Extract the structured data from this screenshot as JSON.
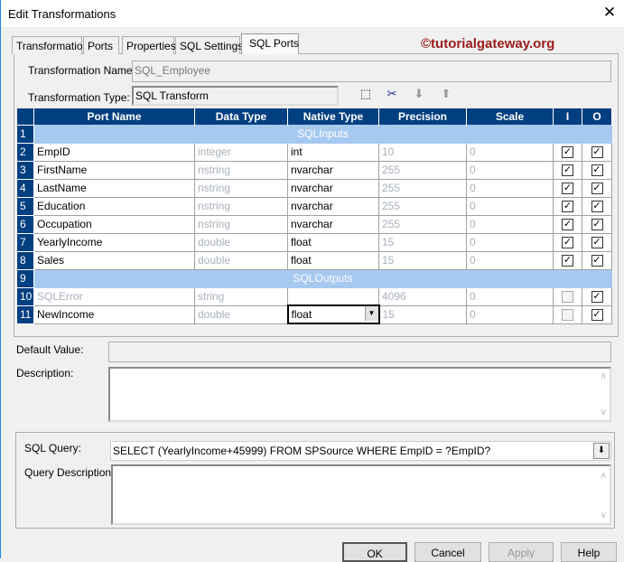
{
  "window": {
    "title": "Edit Transformations",
    "close_icon": "close-icon"
  },
  "tabs": [
    {
      "label": "Transformation"
    },
    {
      "label": "Ports"
    },
    {
      "label": "Properties"
    },
    {
      "label": "SQL Settings"
    },
    {
      "label": "SQL Ports",
      "selected": true
    }
  ],
  "watermark": "©tutorialgateway.org",
  "form": {
    "name_label": "Transformation Name:",
    "name_value": "SQL_Employee",
    "type_label": "Transformation Type:",
    "type_value": "SQL Transform",
    "toolbar": [
      "new-port-icon",
      "cut-icon",
      "move-down-icon",
      "move-up-icon"
    ],
    "default_label": "Default Value:",
    "default_value": "",
    "description_label": "Description:",
    "description_value": ""
  },
  "grid": {
    "columns": [
      "Port Name",
      "Data Type",
      "Native Type",
      "Precision",
      "Scale",
      "I",
      "O"
    ],
    "rows": [
      {
        "n": "1",
        "group": "SQLInputs"
      },
      {
        "n": "2",
        "name": "EmpID",
        "dtype": "integer",
        "native": "int",
        "prec": "10",
        "scale": "0",
        "i": true,
        "o": true
      },
      {
        "n": "3",
        "name": "FirstName",
        "dtype": "nstring",
        "native": "nvarchar",
        "prec": "255",
        "scale": "0",
        "i": true,
        "o": true
      },
      {
        "n": "4",
        "name": "LastName",
        "dtype": "nstring",
        "native": "nvarchar",
        "prec": "255",
        "scale": "0",
        "i": true,
        "o": true
      },
      {
        "n": "5",
        "name": "Education",
        "dtype": "nstring",
        "native": "nvarchar",
        "prec": "255",
        "scale": "0",
        "i": true,
        "o": true
      },
      {
        "n": "6",
        "name": "Occupation",
        "dtype": "nstring",
        "native": "nvarchar",
        "prec": "255",
        "scale": "0",
        "i": true,
        "o": true
      },
      {
        "n": "7",
        "name": "YearlyIncome",
        "dtype": "double",
        "native": "float",
        "prec": "15",
        "scale": "0",
        "i": true,
        "o": true
      },
      {
        "n": "8",
        "name": "Sales",
        "dtype": "double",
        "native": "float",
        "prec": "15",
        "scale": "0",
        "i": true,
        "o": true
      },
      {
        "n": "9",
        "group": "SQLOutputs"
      },
      {
        "n": "10",
        "name": "SQLError",
        "dtype": "string",
        "native": "",
        "prec": "4096",
        "scale": "0",
        "i": false,
        "o": true,
        "disabled": true
      },
      {
        "n": "11",
        "name": "NewIncome",
        "dtype": "double",
        "native": "float",
        "prec": "15",
        "scale": "0",
        "i": false,
        "o": true,
        "editing": true
      }
    ]
  },
  "sql": {
    "query_label": "SQL Query:",
    "query_value": "SELECT (YearlyIncome+45999) FROM SPSource WHERE EmpID = ?EmpID?",
    "qdesc_label": "Query Description:",
    "qdesc_value": ""
  },
  "buttons": {
    "ok": "OK",
    "cancel": "Cancel",
    "apply": "Apply",
    "help": "Help"
  }
}
